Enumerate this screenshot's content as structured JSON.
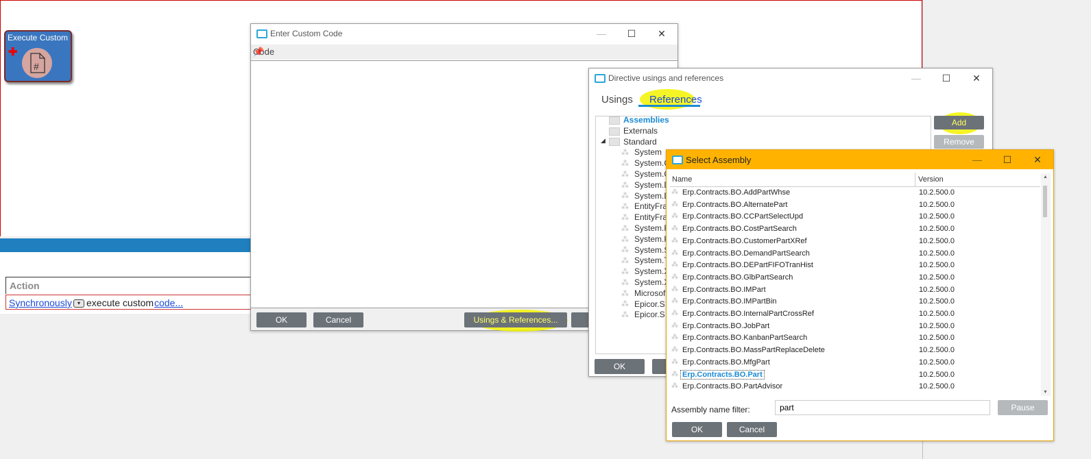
{
  "node": {
    "title": "Execute Custom Code"
  },
  "action_panel": {
    "header": "Action",
    "sync_link": "Synchronously",
    "middle_text": "execute custom",
    "code_link": "code..."
  },
  "code_window": {
    "title": "Enter Custom Code",
    "code_label": "Code",
    "ok": "OK",
    "cancel": "Cancel",
    "usings_button": "Usings & References..."
  },
  "directive_window": {
    "title": "Directive usings and references",
    "tabs": [
      "Usings",
      "References"
    ],
    "add": "Add",
    "remove": "Remove",
    "ok": "OK",
    "tree": [
      {
        "label": "Assemblies",
        "kind": "folder",
        "level": 0
      },
      {
        "label": "Externals",
        "kind": "folder",
        "level": 0
      },
      {
        "label": "Standard",
        "kind": "folder",
        "level": 0
      },
      {
        "label": "System",
        "kind": "asm",
        "level": 1
      },
      {
        "label": "System.C",
        "kind": "asm",
        "level": 1
      },
      {
        "label": "System.C",
        "kind": "asm",
        "level": 1
      },
      {
        "label": "System.D",
        "kind": "asm",
        "level": 1
      },
      {
        "label": "System.D",
        "kind": "asm",
        "level": 1
      },
      {
        "label": "EntityFra",
        "kind": "asm",
        "level": 1
      },
      {
        "label": "EntityFra",
        "kind": "asm",
        "level": 1
      },
      {
        "label": "System.R",
        "kind": "asm",
        "level": 1
      },
      {
        "label": "System.R",
        "kind": "asm",
        "level": 1
      },
      {
        "label": "System.S",
        "kind": "asm",
        "level": 1
      },
      {
        "label": "System.T",
        "kind": "asm",
        "level": 1
      },
      {
        "label": "System.X",
        "kind": "asm",
        "level": 1
      },
      {
        "label": "System.X",
        "kind": "asm",
        "level": 1
      },
      {
        "label": "Microsof",
        "kind": "asm",
        "level": 1
      },
      {
        "label": "Epicor.S",
        "kind": "asm",
        "level": 1
      },
      {
        "label": "Epicor.S",
        "kind": "asm",
        "level": 1
      }
    ]
  },
  "select_assembly": {
    "title": "Select Assembly",
    "col_name": "Name",
    "col_version": "Version",
    "rows": [
      {
        "name": "Erp.Contracts.BO.AddPartWhse",
        "version": "10.2.500.0"
      },
      {
        "name": "Erp.Contracts.BO.AlternatePart",
        "version": "10.2.500.0"
      },
      {
        "name": "Erp.Contracts.BO.CCPartSelectUpd",
        "version": "10.2.500.0"
      },
      {
        "name": "Erp.Contracts.BO.CostPartSearch",
        "version": "10.2.500.0"
      },
      {
        "name": "Erp.Contracts.BO.CustomerPartXRef",
        "version": "10.2.500.0"
      },
      {
        "name": "Erp.Contracts.BO.DemandPartSearch",
        "version": "10.2.500.0"
      },
      {
        "name": "Erp.Contracts.BO.DEPartFIFOTranHist",
        "version": "10.2.500.0"
      },
      {
        "name": "Erp.Contracts.BO.GlbPartSearch",
        "version": "10.2.500.0"
      },
      {
        "name": "Erp.Contracts.BO.IMPart",
        "version": "10.2.500.0"
      },
      {
        "name": "Erp.Contracts.BO.IMPartBin",
        "version": "10.2.500.0"
      },
      {
        "name": "Erp.Contracts.BO.InternalPartCrossRef",
        "version": "10.2.500.0"
      },
      {
        "name": "Erp.Contracts.BO.JobPart",
        "version": "10.2.500.0"
      },
      {
        "name": "Erp.Contracts.BO.KanbanPartSearch",
        "version": "10.2.500.0"
      },
      {
        "name": "Erp.Contracts.BO.MassPartReplaceDelete",
        "version": "10.2.500.0"
      },
      {
        "name": "Erp.Contracts.BO.MfgPart",
        "version": "10.2.500.0"
      },
      {
        "name": "Erp.Contracts.BO.Part",
        "version": "10.2.500.0",
        "selected": true
      },
      {
        "name": "Erp.Contracts.BO.PartAdvisor",
        "version": "10.2.500.0"
      }
    ],
    "filter_label": "Assembly name filter:",
    "filter_value": "part",
    "pause": "Pause",
    "ok": "OK",
    "cancel": "Cancel"
  },
  "colors": {
    "accent_blue": "#1a8ad4",
    "title_orange": "#ffb300",
    "highlight": "#f2f200"
  }
}
